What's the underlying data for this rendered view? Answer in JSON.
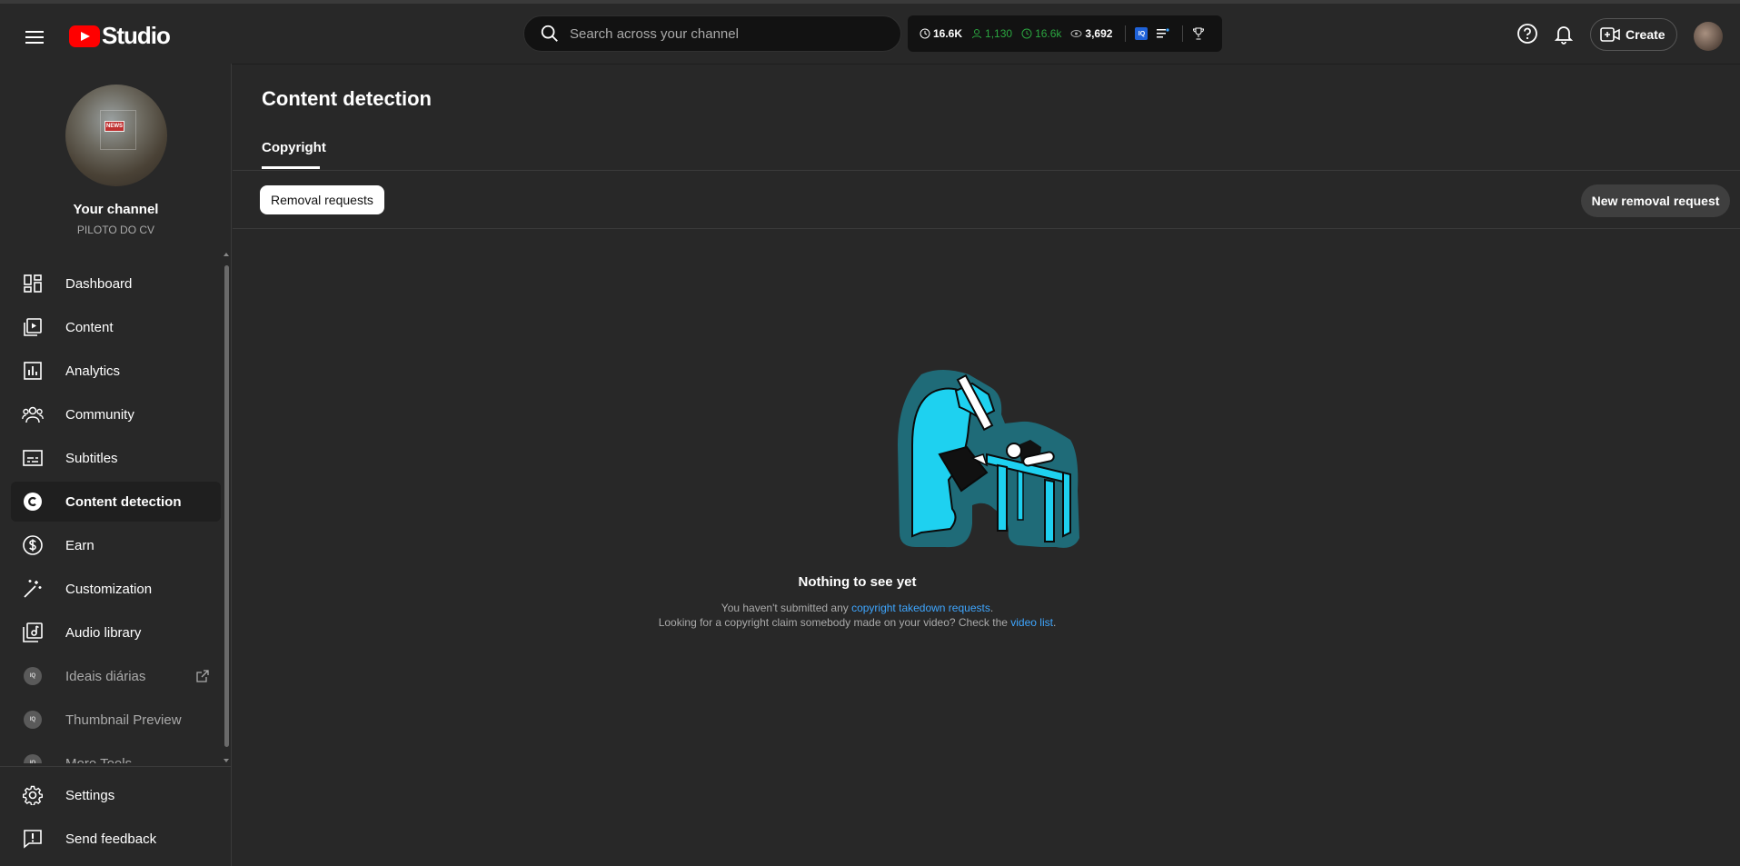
{
  "app": {
    "logo_text": "Studio"
  },
  "search": {
    "placeholder": "Search across your channel"
  },
  "stats": {
    "hours": "16.6K",
    "subs": "1,130",
    "watch": "16.6k",
    "views": "3,692",
    "badge": "IQ"
  },
  "header": {
    "create_label": "Create"
  },
  "channel": {
    "title": "Your channel",
    "name": "PILOTO DO CV",
    "avatar_badge": "NEWS"
  },
  "nav": {
    "items": [
      {
        "label": "Dashboard",
        "icon": "dashboard-icon"
      },
      {
        "label": "Content",
        "icon": "content-icon"
      },
      {
        "label": "Analytics",
        "icon": "analytics-icon"
      },
      {
        "label": "Community",
        "icon": "community-icon"
      },
      {
        "label": "Subtitles",
        "icon": "subtitles-icon"
      },
      {
        "label": "Content detection",
        "icon": "copyright-icon"
      },
      {
        "label": "Earn",
        "icon": "dollar-icon"
      },
      {
        "label": "Customization",
        "icon": "magic-wand-icon"
      },
      {
        "label": "Audio library",
        "icon": "audio-library-icon"
      },
      {
        "label": "Ideais diárias",
        "icon": "vidiq-icon"
      },
      {
        "label": "Thumbnail Preview",
        "icon": "vidiq-icon"
      },
      {
        "label": "More Tools",
        "icon": "vidiq-icon"
      }
    ],
    "settings": "Settings",
    "feedback": "Send feedback"
  },
  "main": {
    "title": "Content detection",
    "tab": "Copyright",
    "chip": "Removal requests",
    "new_request": "New removal request",
    "empty_title": "Nothing to see yet",
    "line1_pre": "You haven't submitted any ",
    "line1_link": "copyright takedown requests",
    "line1_post": ".",
    "line2_pre": "Looking for a copyright claim somebody made on your video? Check the ",
    "line2_link": "video list",
    "line2_post": "."
  },
  "colors": {
    "accent_red": "#ff0000",
    "link_blue": "#3ea6ff",
    "green": "#2ba640",
    "illustration_cyan": "#1ed1f0",
    "illustration_teal": "#1f6b78"
  }
}
